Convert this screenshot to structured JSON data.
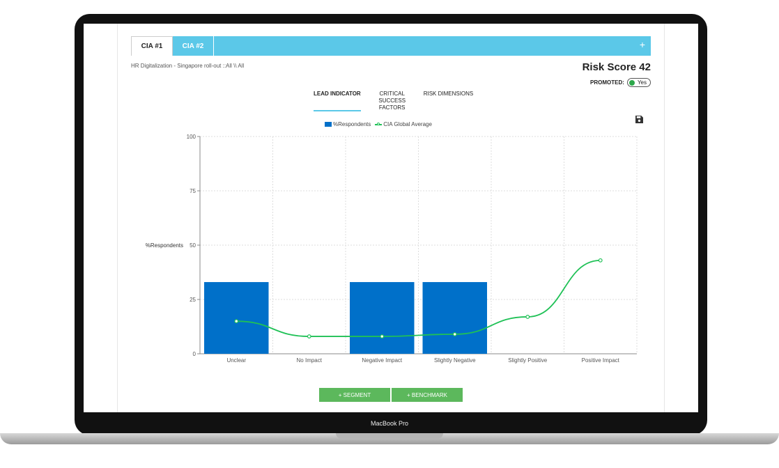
{
  "device": {
    "label": "MacBook Pro"
  },
  "tabs": [
    {
      "label": "CIA #1"
    },
    {
      "label": "CIA #2"
    }
  ],
  "add_icon": "+",
  "breadcrumb": "HR Digitalization - Singapore roll-out ::All \\\\ All",
  "risk_score": "Risk Score 42",
  "promoted": {
    "label": "PROMOTED:",
    "value": "Yes"
  },
  "subtabs": [
    {
      "label": "LEAD INDICATOR"
    },
    {
      "label": "CRITICAL SUCCESS FACTORS"
    },
    {
      "label": "RISK DIMENSIONS"
    }
  ],
  "buttons": {
    "segment": "+ SEGMENT",
    "benchmark": "+ BENCHMARK"
  },
  "colors": {
    "accent": "#5bc8e8",
    "bar": "#0070c9",
    "line": "#1fc156",
    "button": "#5cb85c"
  },
  "chart_data": {
    "type": "bar",
    "categories": [
      "Unclear",
      "No Impact",
      "Negative Impact",
      "Slightly Negative",
      "Slightly Positive",
      "Positive Impact"
    ],
    "series": [
      {
        "name": "%Respondents",
        "type": "bar",
        "values": [
          33,
          0,
          33,
          33,
          0,
          0
        ]
      },
      {
        "name": "CIA Global Average",
        "type": "line",
        "values": [
          15,
          8,
          8,
          9,
          17,
          43
        ]
      }
    ],
    "ylabel": "%Respondents",
    "ylim": [
      0,
      100
    ],
    "yticks": [
      0,
      25,
      50,
      75,
      100
    ],
    "grid": true,
    "legend": "top"
  }
}
